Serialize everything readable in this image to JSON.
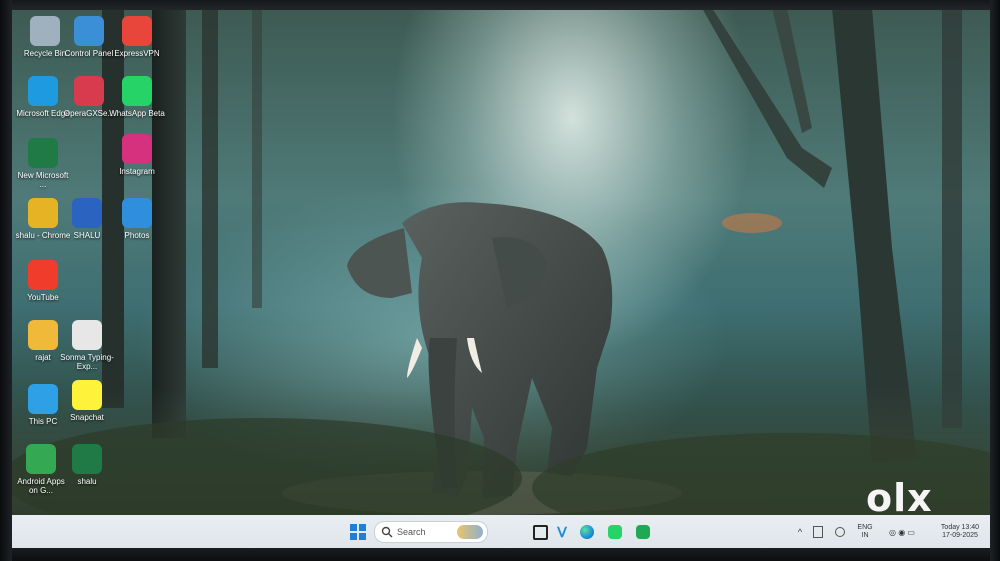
{
  "desktop": {
    "icons": [
      {
        "label": "Recycle Bin",
        "icon": "recycle-bin-icon",
        "color": "#9fb0bf"
      },
      {
        "label": "Control Panel",
        "icon": "control-panel-icon",
        "color": "#3b8fd6"
      },
      {
        "label": "ExpressVPN",
        "icon": "expressvpn-icon",
        "color": "#e8463b"
      },
      {
        "label": "Microsoft Edge",
        "icon": "edge-icon",
        "color": "#1e9be0"
      },
      {
        "label": "OperaGXSe...",
        "icon": "opera-gx-icon",
        "color": "#d83a4e"
      },
      {
        "label": "WhatsApp Beta",
        "icon": "whatsapp-icon",
        "color": "#25d366"
      },
      {
        "label": "New Microsoft ...",
        "icon": "excel-icon",
        "color": "#1f7a45"
      },
      {
        "label": "Instagram",
        "icon": "instagram-icon",
        "color": "#d6317f"
      },
      {
        "label": "shalu - Chrome",
        "icon": "chrome-icon",
        "color": "#e5b323"
      },
      {
        "label": "SHALU",
        "icon": "word-icon",
        "color": "#2b63c0"
      },
      {
        "label": "Photos",
        "icon": "photos-icon",
        "color": "#2f8fdc"
      },
      {
        "label": "YouTube",
        "icon": "youtube-icon",
        "color": "#f03d2b"
      },
      {
        "label": "rajat",
        "icon": "folder-icon",
        "color": "#f0b93a"
      },
      {
        "label": "Sonma Typing-Exp...",
        "icon": "typing-app-icon",
        "color": "#e7e7e7"
      },
      {
        "label": "This PC",
        "icon": "this-pc-icon",
        "color": "#2ea0e6"
      },
      {
        "label": "Snapchat",
        "icon": "snapchat-icon",
        "color": "#fff23a"
      },
      {
        "label": "Android Apps on G...",
        "icon": "google-play-icon",
        "color": "#34a853"
      },
      {
        "label": "shalu",
        "icon": "excel-file-icon",
        "color": "#1f7a45"
      }
    ]
  },
  "taskbar": {
    "search_placeholder": "Search",
    "tray_lang_1": "ENG",
    "tray_lang_2": "IN",
    "tray_status": "Today 13:40",
    "tray_date": "17-09-2025"
  },
  "watermark": "olx"
}
